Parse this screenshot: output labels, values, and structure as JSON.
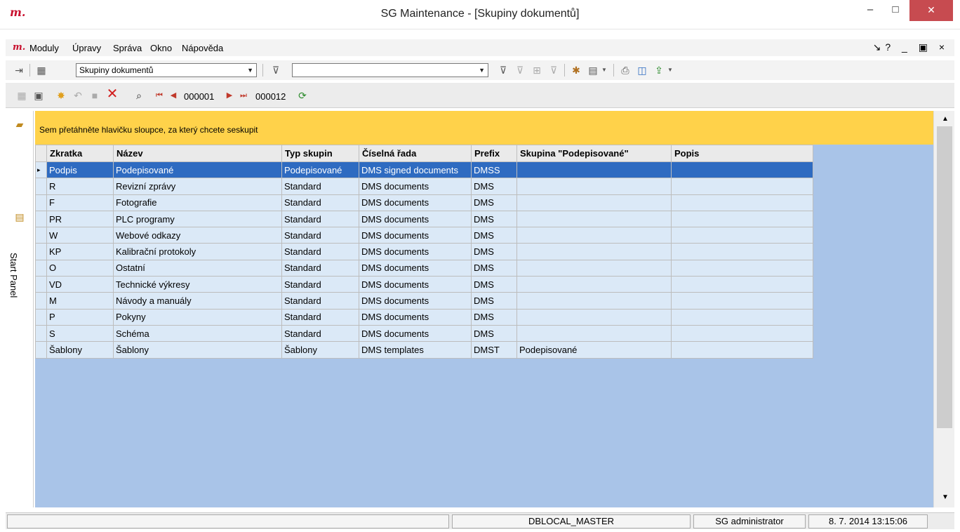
{
  "window": {
    "title": "SG Maintenance - [Skupiny dokumentů]",
    "logo": "m.",
    "min_label": "–",
    "max_label": "□",
    "close_label": "✕"
  },
  "menu": {
    "logo": "m.",
    "items": [
      "Moduly",
      "Úpravy",
      "Správa",
      "Okno",
      "Nápověda"
    ],
    "right_label": "↘? _ ▣ ×"
  },
  "toolbar": {
    "view_combo": "Skupiny dokumentů",
    "filter_combo": ""
  },
  "nav": {
    "current": "000001",
    "total": "000012"
  },
  "side": {
    "start_panel": "Start Panel"
  },
  "grid": {
    "group_hint": "Sem přetáhněte hlavičku sloupce, za který chcete seskupit",
    "columns": [
      "Zkratka",
      "Název",
      "Typ skupin",
      "Číselná řada",
      "Prefix",
      "Skupina \"Podepisované\"",
      "Popis"
    ],
    "rows": [
      [
        "Podpis",
        "Podepisované",
        "Podepisované",
        "DMS signed documents",
        "DMSS",
        "",
        ""
      ],
      [
        "R",
        "Revizní zprávy",
        "Standard",
        "DMS documents",
        "DMS",
        "",
        ""
      ],
      [
        "F",
        "Fotografie",
        "Standard",
        "DMS documents",
        "DMS",
        "",
        ""
      ],
      [
        "PR",
        "PLC programy",
        "Standard",
        "DMS documents",
        "DMS",
        "",
        ""
      ],
      [
        "W",
        "Webové odkazy",
        "Standard",
        "DMS documents",
        "DMS",
        "",
        ""
      ],
      [
        "KP",
        "Kalibrační protokoly",
        "Standard",
        "DMS documents",
        "DMS",
        "",
        ""
      ],
      [
        "O",
        "Ostatní",
        "Standard",
        "DMS documents",
        "DMS",
        "",
        ""
      ],
      [
        "VD",
        "Technické výkresy",
        "Standard",
        "DMS documents",
        "DMS",
        "",
        ""
      ],
      [
        "M",
        "Návody a manuály",
        "Standard",
        "DMS documents",
        "DMS",
        "",
        ""
      ],
      [
        "P",
        "Pokyny",
        "Standard",
        "DMS documents",
        "DMS",
        "",
        ""
      ],
      [
        "S",
        "Schéma",
        "Standard",
        "DMS documents",
        "DMS",
        "",
        ""
      ],
      [
        "Šablony",
        "Šablony",
        "Šablony",
        "DMS templates",
        "DMST",
        "Podepisované",
        ""
      ]
    ]
  },
  "status": {
    "database": "DBLOCAL_MASTER",
    "user": "SG administrator",
    "datetime": "8. 7. 2014 13:15:06"
  },
  "colors": {
    "accent_red": "#c8102e",
    "selection": "#2e6bc1",
    "group_bar": "#ffd24a",
    "grid_bg": "#a9c4e8"
  }
}
